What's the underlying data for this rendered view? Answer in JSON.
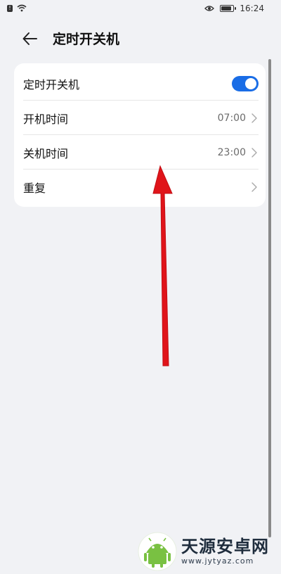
{
  "status_bar": {
    "time": "16:24",
    "alert_glyph": "!",
    "icons": [
      "alert-icon",
      "wifi-icon",
      "eye-icon",
      "battery-icon"
    ]
  },
  "header": {
    "title": "定时开关机",
    "back_icon": "arrow-left-icon"
  },
  "settings": {
    "rows": [
      {
        "label": "定时开关机",
        "control": "toggle",
        "on": true
      },
      {
        "label": "开机时间",
        "value": "07:00",
        "icon": "chevron-right-icon"
      },
      {
        "label": "关机时间",
        "value": "23:00",
        "icon": "chevron-right-icon"
      },
      {
        "label": "重复",
        "value": "",
        "icon": "chevron-right-icon"
      }
    ]
  },
  "annotation": {
    "type": "arrow",
    "color": "#e0141a"
  },
  "watermark": {
    "title": "天源安卓网",
    "url": "www.jytyaz.com",
    "logo_icon": "android-logo-icon"
  },
  "colors": {
    "background": "#f1f2f5",
    "card": "#ffffff",
    "toggle_on": "#1a6de6",
    "arrow": "#e0141a"
  }
}
